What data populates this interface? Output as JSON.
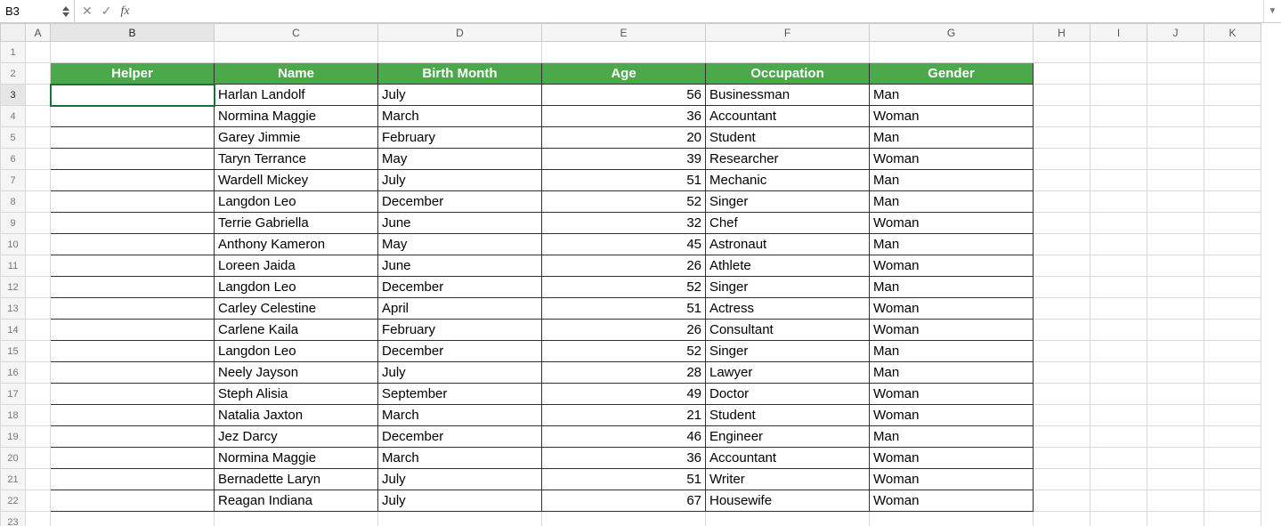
{
  "nameBox": "B3",
  "formula": "",
  "columns": [
    "A",
    "B",
    "C",
    "D",
    "E",
    "F",
    "G",
    "H",
    "I",
    "J",
    "K"
  ],
  "headers": {
    "B": "Helper",
    "C": "Name",
    "D": "Birth Month",
    "E": "Age",
    "F": "Occupation",
    "G": "Gender"
  },
  "rows": [
    {
      "helper": "",
      "name": "Harlan Landolf",
      "month": "July",
      "age": 56,
      "occ": "Businessman",
      "gender": "Man"
    },
    {
      "helper": "",
      "name": "Normina Maggie",
      "month": "March",
      "age": 36,
      "occ": "Accountant",
      "gender": "Woman"
    },
    {
      "helper": "",
      "name": "Garey Jimmie",
      "month": "February",
      "age": 20,
      "occ": "Student",
      "gender": "Man"
    },
    {
      "helper": "",
      "name": "Taryn Terrance",
      "month": "May",
      "age": 39,
      "occ": "Researcher",
      "gender": "Woman"
    },
    {
      "helper": "",
      "name": "Wardell Mickey",
      "month": "July",
      "age": 51,
      "occ": "Mechanic",
      "gender": "Man"
    },
    {
      "helper": "",
      "name": "Langdon Leo",
      "month": "December",
      "age": 52,
      "occ": "Singer",
      "gender": "Man"
    },
    {
      "helper": "",
      "name": "Terrie Gabriella",
      "month": "June",
      "age": 32,
      "occ": "Chef",
      "gender": "Woman"
    },
    {
      "helper": "",
      "name": "Anthony Kameron",
      "month": "May",
      "age": 45,
      "occ": "Astronaut",
      "gender": "Man"
    },
    {
      "helper": "",
      "name": "Loreen Jaida",
      "month": "June",
      "age": 26,
      "occ": "Athlete",
      "gender": "Woman"
    },
    {
      "helper": "",
      "name": "Langdon Leo",
      "month": "December",
      "age": 52,
      "occ": "Singer",
      "gender": "Man"
    },
    {
      "helper": "",
      "name": "Carley Celestine",
      "month": "April",
      "age": 51,
      "occ": "Actress",
      "gender": "Woman"
    },
    {
      "helper": "",
      "name": "Carlene Kaila",
      "month": "February",
      "age": 26,
      "occ": "Consultant",
      "gender": "Woman"
    },
    {
      "helper": "",
      "name": "Langdon Leo",
      "month": "December",
      "age": 52,
      "occ": "Singer",
      "gender": "Man"
    },
    {
      "helper": "",
      "name": "Neely Jayson",
      "month": "July",
      "age": 28,
      "occ": "Lawyer",
      "gender": "Man"
    },
    {
      "helper": "",
      "name": "Steph Alisia",
      "month": "September",
      "age": 49,
      "occ": "Doctor",
      "gender": "Woman"
    },
    {
      "helper": "",
      "name": "Natalia Jaxton",
      "month": "March",
      "age": 21,
      "occ": "Student",
      "gender": "Woman"
    },
    {
      "helper": "",
      "name": "Jez Darcy",
      "month": "December",
      "age": 46,
      "occ": "Engineer",
      "gender": "Man"
    },
    {
      "helper": "",
      "name": "Normina Maggie",
      "month": "March",
      "age": 36,
      "occ": "Accountant",
      "gender": "Woman"
    },
    {
      "helper": "",
      "name": "Bernadette Laryn",
      "month": "July",
      "age": 51,
      "occ": "Writer",
      "gender": "Woman"
    },
    {
      "helper": "",
      "name": "Reagan Indiana",
      "month": "July",
      "age": 67,
      "occ": "Housewife",
      "gender": "Woman"
    }
  ],
  "fx": {
    "cancel": "✕",
    "accept": "✓",
    "label": "fx"
  },
  "expand": "▼"
}
